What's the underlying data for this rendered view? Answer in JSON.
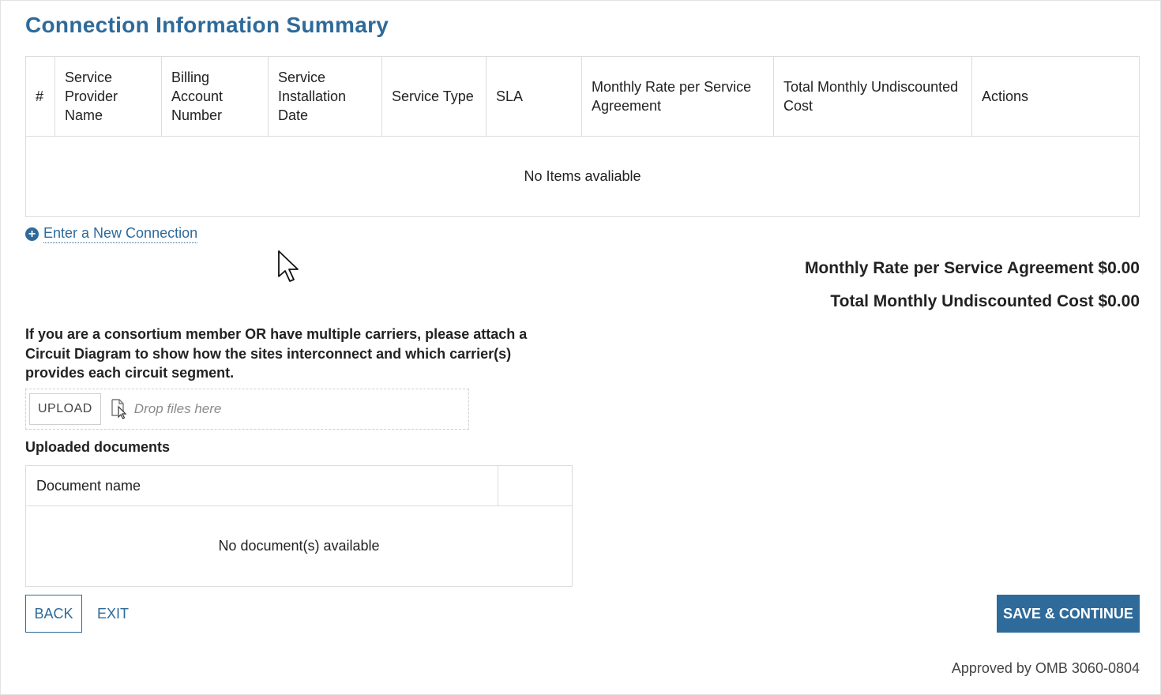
{
  "page": {
    "title": "Connection Information Summary"
  },
  "table": {
    "headers": [
      "#",
      "Service Provider Name",
      "Billing Account Number",
      "Service Installation Date",
      "Service Type",
      "SLA",
      "Monthly Rate per Service Agreement",
      "Total Monthly Undiscounted Cost",
      "Actions"
    ],
    "empty_text": "No Items avaliable"
  },
  "add_connection": {
    "label": "Enter a New Connection",
    "icon": "plus-circle-icon"
  },
  "totals": {
    "monthly_rate": "Monthly Rate per Service Agreement $0.00",
    "total_cost": "Total Monthly Undiscounted Cost $0.00"
  },
  "instructions": "If you are a consortium member OR have multiple carriers, please attach a Circuit Diagram to show how the sites interconnect and which carrier(s) provides each circuit segment.",
  "upload": {
    "button_label": "UPLOAD",
    "drop_text": "Drop files here",
    "icon": "file-drop-icon"
  },
  "documents": {
    "label": "Uploaded documents",
    "headers": [
      "Document name",
      ""
    ],
    "empty_text": "No document(s) available"
  },
  "footer": {
    "back_label": "BACK",
    "exit_label": "EXIT",
    "save_label": "SAVE & CONTINUE",
    "omb_text": "Approved by OMB 3060-0804"
  },
  "colors": {
    "accent": "#2e6a9a",
    "border": "#dcdcdc",
    "text": "#222222"
  }
}
